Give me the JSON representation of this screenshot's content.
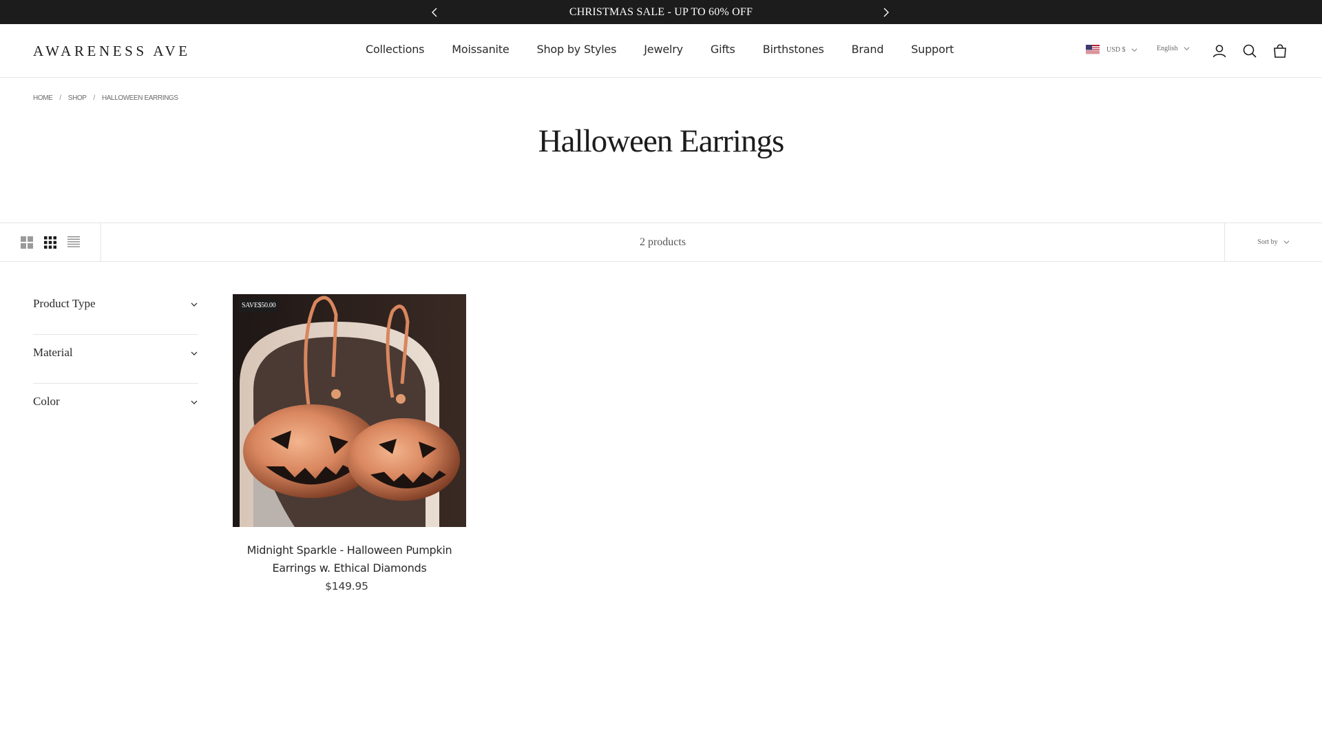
{
  "announcement": {
    "text": "CHRISTMAS SALE - UP TO 60% OFF",
    "prev_icon": "chevron-left-icon",
    "next_icon": "chevron-right-icon"
  },
  "header": {
    "logo": "AWARENESS AVE",
    "nav": [
      "Collections",
      "Moissanite",
      "Shop by Styles",
      "Jewelry",
      "Gifts",
      "Birthstones",
      "Brand",
      "Support"
    ],
    "currency": "USD $",
    "language": "English",
    "icons": [
      "account-icon",
      "search-icon",
      "cart-icon"
    ]
  },
  "breadcrumb": {
    "home": "HOME",
    "shop": "SHOP",
    "current": "HALLOWEEN EARRINGS",
    "separator": "/"
  },
  "page": {
    "title": "Halloween Earrings"
  },
  "toolbar": {
    "product_count": "2 products",
    "sort_label": "Sort by",
    "layout_icons": [
      "grid-large-icon",
      "grid-small-icon",
      "list-icon"
    ]
  },
  "filters": [
    {
      "label": "Product Type"
    },
    {
      "label": "Material"
    },
    {
      "label": "Color"
    }
  ],
  "products": [
    {
      "badge": "SAVE$50.00",
      "title": "Midnight Sparkle - Halloween Pumpkin Earrings w. Ethical Diamonds",
      "price": "$149.95"
    }
  ],
  "colors": {
    "announcement_bg": "#1c1c1c",
    "text": "#1c1c1c",
    "border": "#e4e4e4",
    "rose_gold": "#d9875f"
  }
}
